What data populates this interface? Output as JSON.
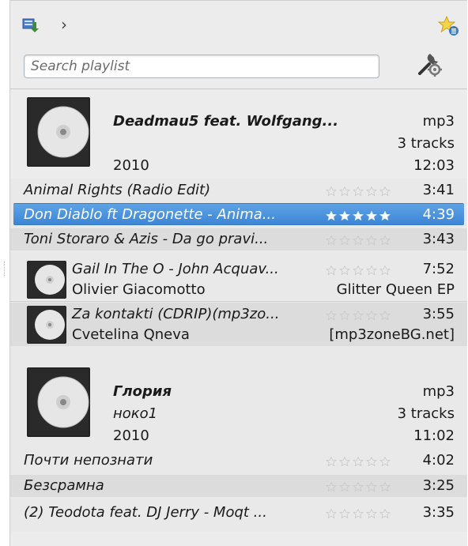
{
  "toolbar": {
    "nav_icon": "playlist-import-icon",
    "chevron": "›",
    "favorites_icon": "star-favorite-icon"
  },
  "search": {
    "placeholder": "Search playlist",
    "tools_icon": "tools-icon"
  },
  "colors": {
    "selection": "#3d86d6",
    "star_empty": "#c9c9c9",
    "star_full": "#ffffff"
  },
  "albums": [
    {
      "title": "Deadmau5  feat. Wolfgang...",
      "artist": "",
      "year": "2010",
      "format": "mp3",
      "track_count": "3 tracks",
      "total_length": "12:03",
      "tracks": [
        {
          "name": "Animal Rights (Radio Edit)",
          "rating": 0,
          "length": "3:41"
        },
        {
          "name": "Don Diablo ft Dragonette - Anima...",
          "rating": 5,
          "length": "4:39"
        },
        {
          "name": "Toni Storaro & Azis - Da go pravi...",
          "rating": 0,
          "length": "3:43"
        }
      ]
    },
    {
      "title": "Глория",
      "artist": "ноко1",
      "year": "2010",
      "format": "mp3",
      "track_count": "3 tracks",
      "total_length": "11:02",
      "tracks": [
        {
          "name": "Почти непознати",
          "rating": 0,
          "length": "4:02"
        },
        {
          "name": "Безсрамна",
          "rating": 0,
          "length": "3:25"
        },
        {
          "name": "(2) Teodota feat. DJ Jerry - Moqt ...",
          "rating": 0,
          "length": "3:35"
        }
      ]
    }
  ],
  "singles": [
    {
      "title": "Gail In The O - John Acquav...",
      "artist": "Olivier Giacomotto",
      "album": "Glitter Queen EP",
      "rating": 0,
      "length": "7:52"
    },
    {
      "title": "Za kontakti (CDRIP)(mp3zo...",
      "artist": "Cvetelina Qneva",
      "album": "[mp3zoneBG.net]",
      "rating": 0,
      "length": "3:55"
    }
  ]
}
